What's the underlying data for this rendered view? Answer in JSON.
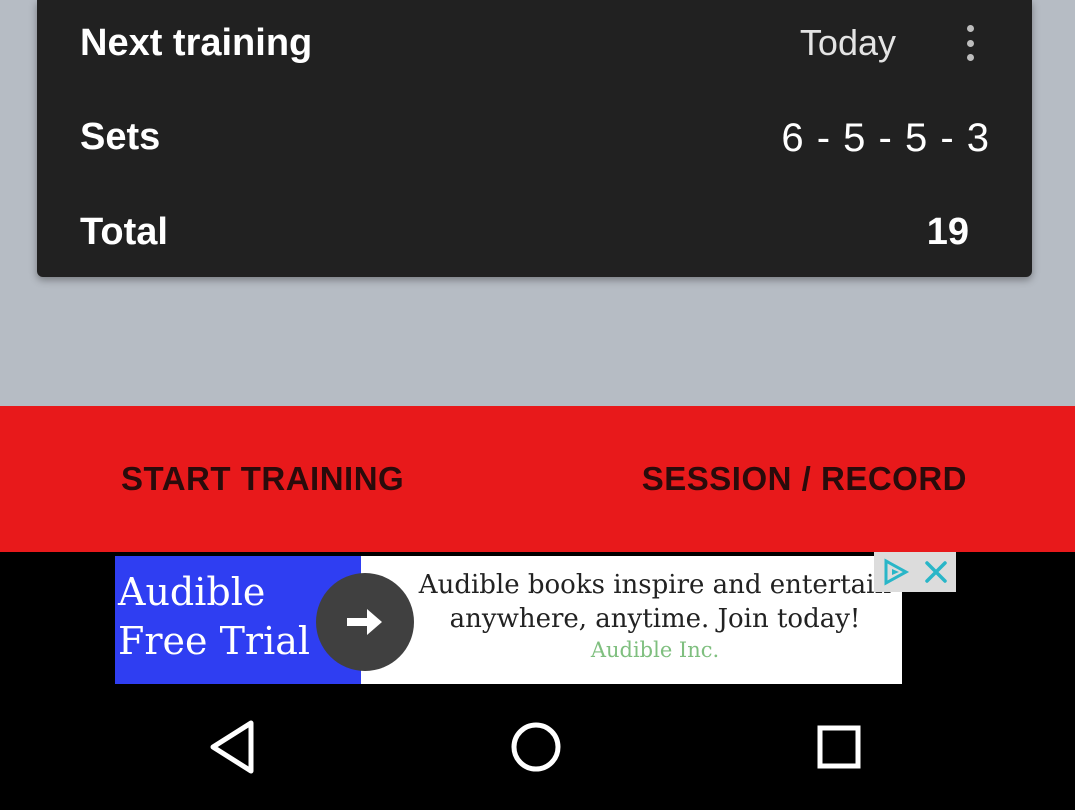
{
  "card": {
    "next_label": "Next training",
    "next_value": "Today",
    "sets_label": "Sets",
    "sets_value": "6 - 5 - 5 - 3",
    "total_label": "Total",
    "total_value": "19",
    "more_icon": "more-vert-icon"
  },
  "actions": {
    "start_label": "START TRAINING",
    "session_label": "SESSION / RECORD"
  },
  "ad": {
    "title_line1": "Audible",
    "title_line2": "Free Trial",
    "text_line1": "Audible books inspire and entertain",
    "text_line2": "anywhere, anytime. Join today!",
    "advertiser": "Audible Inc.",
    "arrow_icon": "arrow-right-icon",
    "adchoices_icon": "adchoices-icon",
    "close_icon": "close-icon"
  },
  "navbar": {
    "back_icon": "back-triangle-icon",
    "home_icon": "home-circle-icon",
    "recents_icon": "recents-square-icon"
  },
  "colors": {
    "card_bg": "#212121",
    "accent_red": "#e8191b",
    "background": "#b6bcc4",
    "ad_blue": "#2f3ef2",
    "adchoices_teal": "#29b6c8"
  }
}
